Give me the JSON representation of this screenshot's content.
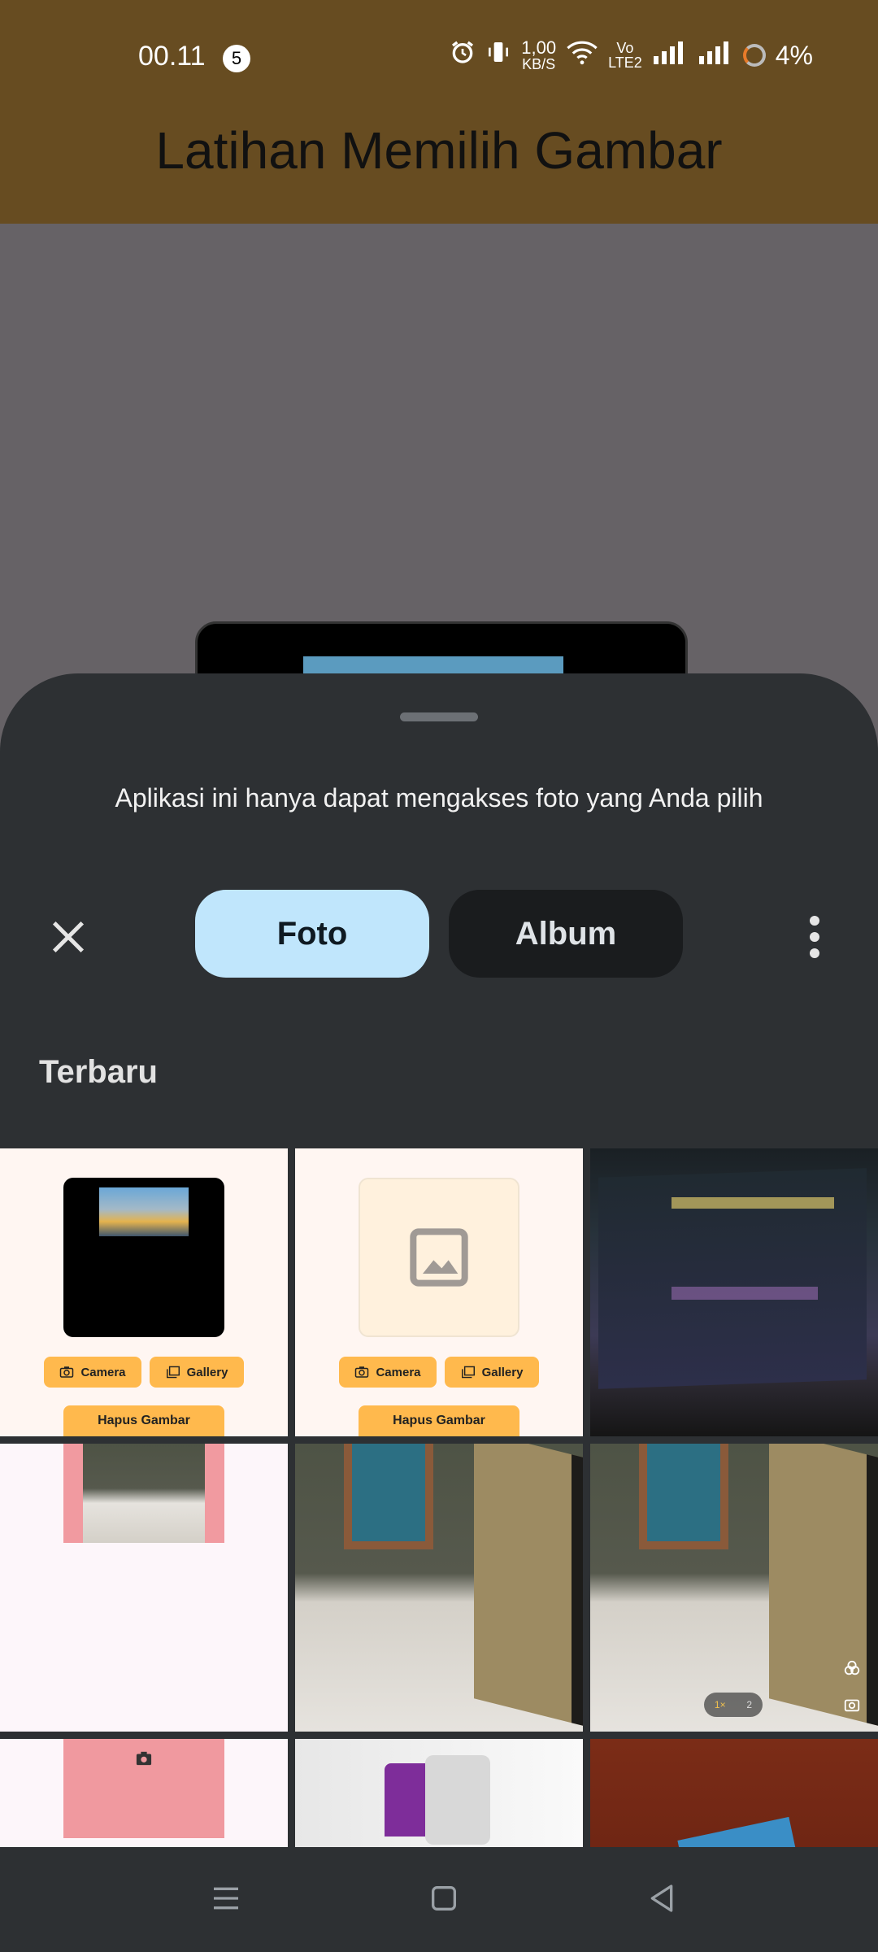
{
  "status_bar": {
    "time": "00.11",
    "notification_count": "5",
    "speed_value": "1,00",
    "speed_unit": "KB/S",
    "network_label_top": "Vo",
    "network_label_bottom": "LTE2",
    "battery": "4%"
  },
  "app_bar": {
    "title": "Latihan Memilih Gambar"
  },
  "picker": {
    "info_text": "Aplikasi ini hanya dapat mengakses foto yang Anda pilih",
    "tabs": [
      {
        "label": "Foto",
        "selected": true
      },
      {
        "label": "Album",
        "selected": false
      }
    ],
    "section_title": "Terbaru",
    "thumbs_app": {
      "camera_label": "Camera",
      "gallery_label": "Gallery",
      "delete_label": "Hapus Gambar"
    },
    "zoom_pill": {
      "a": "1×",
      "b": "2"
    }
  },
  "colors": {
    "header": "#674c21",
    "sheet": "#2d3033",
    "tab_selected": "#c0e6fc",
    "tab_unselected": "#1a1c1e",
    "app_button": "#ffb94d"
  }
}
